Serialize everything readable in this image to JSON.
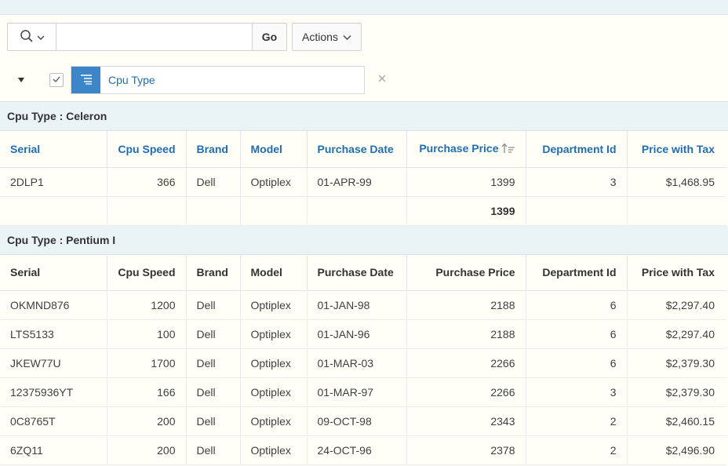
{
  "toolbar": {
    "search_placeholder": "",
    "go_label": "Go",
    "actions_label": "Actions"
  },
  "filter": {
    "label": "Cpu Type"
  },
  "columns": [
    "Serial",
    "Cpu Speed",
    "Brand",
    "Model",
    "Purchase Date",
    "Purchase Price",
    "Department Id",
    "Price with Tax"
  ],
  "groups": [
    {
      "title": "Cpu Type : Celeron",
      "rows": [
        [
          "2DLP1",
          "366",
          "Dell",
          "Optiplex",
          "01-APR-99",
          "1399",
          "3",
          "$1,468.95"
        ]
      ],
      "total": [
        "",
        "",
        "",
        "",
        "",
        "1399",
        "",
        ""
      ]
    },
    {
      "title": "Cpu Type : Pentium I",
      "rows": [
        [
          "OKMND876",
          "1200",
          "Dell",
          "Optiplex",
          "01-JAN-98",
          "2188",
          "6",
          "$2,297.40"
        ],
        [
          "LTS5133",
          "100",
          "Dell",
          "Optiplex",
          "01-JAN-96",
          "2188",
          "6",
          "$2,297.40"
        ],
        [
          "JKEW77U",
          "1700",
          "Dell",
          "Optiplex",
          "01-MAR-03",
          "2266",
          "6",
          "$2,379.30"
        ],
        [
          "12375936YT",
          "166",
          "Dell",
          "Optiplex",
          "01-MAR-97",
          "2266",
          "3",
          "$2,379.30"
        ],
        [
          "0C8765T",
          "200",
          "Dell",
          "Optiplex",
          "09-OCT-98",
          "2343",
          "2",
          "$2,460.15"
        ],
        [
          "6ZQ11",
          "200",
          "Dell",
          "Optiplex",
          "24-OCT-96",
          "2378",
          "2",
          "$2,496.90"
        ]
      ]
    }
  ],
  "colors": {
    "accent": "#3a86c8",
    "link": "#1f6db5",
    "group_bg": "#eaf4f6"
  }
}
